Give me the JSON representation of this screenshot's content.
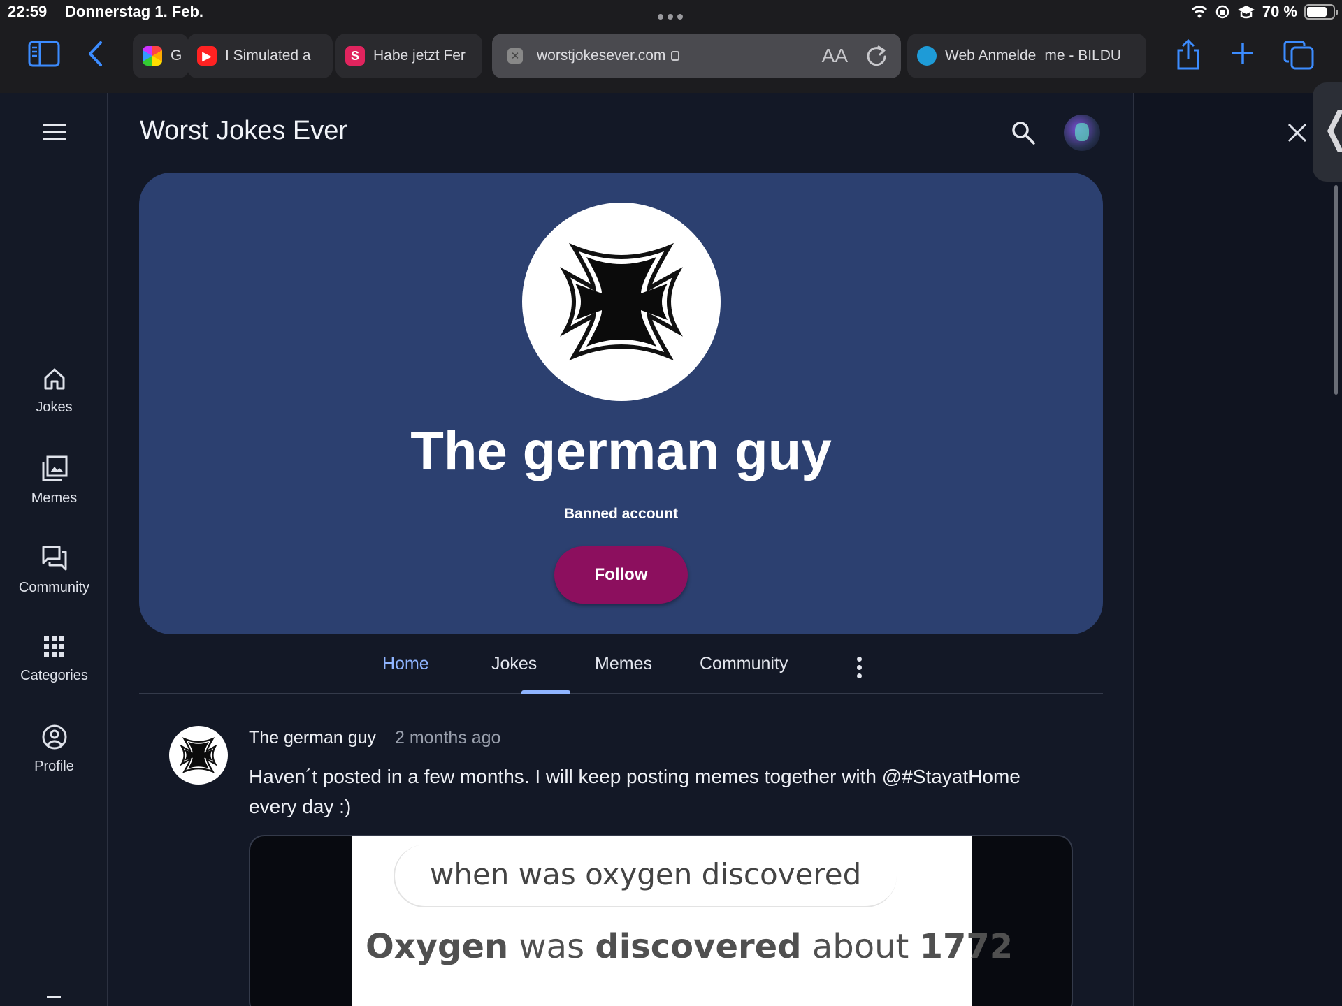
{
  "status_bar": {
    "time": "22:59",
    "date": "Donnerstag 1. Feb.",
    "battery": "70 %"
  },
  "browser": {
    "tabs": [
      {
        "title": "G",
        "favicon": "google-photos-icon"
      },
      {
        "title": "I Simulated a",
        "favicon": "youtube-icon"
      },
      {
        "title": "Habe jetzt Fer",
        "favicon": "s-icon"
      },
      {
        "title": "worstjokesever.com",
        "favicon": "close-tab-icon",
        "active": true
      },
      {
        "title": "Web Anmelde",
        "title_rest": "me - BILDU",
        "favicon": "web-icon"
      }
    ],
    "reader_label": "AA"
  },
  "sidebar": {
    "items": [
      {
        "label": "Jokes",
        "icon": "home-icon"
      },
      {
        "label": "Memes",
        "icon": "image-icon"
      },
      {
        "label": "Community",
        "icon": "chat-icon"
      },
      {
        "label": "Categories",
        "icon": "grid-icon"
      },
      {
        "label": "Profile",
        "icon": "profile-icon"
      }
    ]
  },
  "header": {
    "site_title": "Worst Jokes Ever"
  },
  "profile": {
    "name": "The german guy",
    "status": "Banned account",
    "follow_label": "Follow",
    "accent": "#2c4070",
    "follow_color": "#8c0f5e"
  },
  "profile_tabs": [
    {
      "label": "Home",
      "active": true
    },
    {
      "label": "Jokes"
    },
    {
      "label": "Memes"
    },
    {
      "label": "Community"
    }
  ],
  "post": {
    "author": "The german guy",
    "time": "2 months ago",
    "text": "Haven´t posted in a few months. I will keep posting memes together with @#StayatHome every day :)",
    "image": {
      "question": "when was oxygen discovered",
      "answer_parts": [
        "Oxygen",
        " was ",
        "discovered",
        " about ",
        "1772"
      ]
    }
  }
}
